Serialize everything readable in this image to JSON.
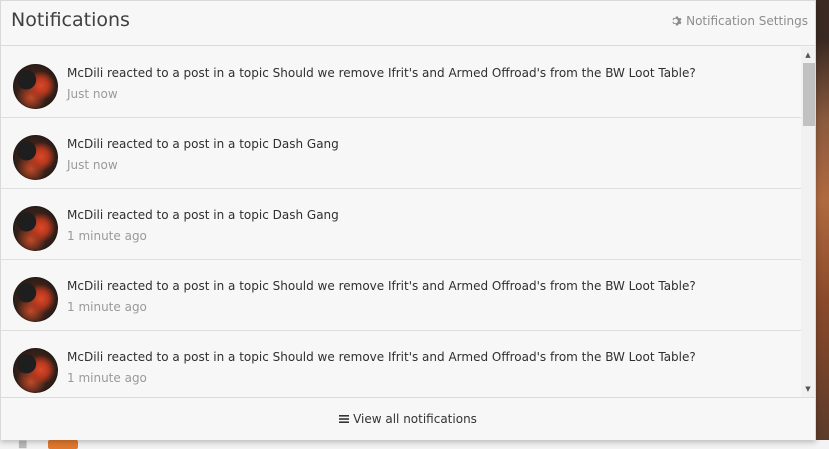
{
  "header": {
    "title": "Notifications",
    "settings_label": "Notification Settings",
    "settings_icon": "gear-icon"
  },
  "notifications": [
    {
      "text": "McDili reacted to a post in a topic Should we remove Ifrit's and Armed Offroad's from the BW Loot Table?",
      "time": "Just now"
    },
    {
      "text": "McDili reacted to a post in a topic Dash Gang",
      "time": "Just now"
    },
    {
      "text": "McDili reacted to a post in a topic Dash Gang",
      "time": "1 minute ago"
    },
    {
      "text": "McDili reacted to a post in a topic Should we remove Ifrit's and Armed Offroad's from the BW Loot Table?",
      "time": "1 minute ago"
    },
    {
      "text": "McDili reacted to a post in a topic Should we remove Ifrit's and Armed Offroad's from the BW Loot Table?",
      "time": "1 minute ago"
    }
  ],
  "footer": {
    "view_all_label": "View all notifications",
    "view_all_icon": "bars-icon"
  },
  "colors": {
    "accent_orange": "#e0792e",
    "panel_bg": "#f7f7f7",
    "muted_text": "#9a9a9a"
  }
}
